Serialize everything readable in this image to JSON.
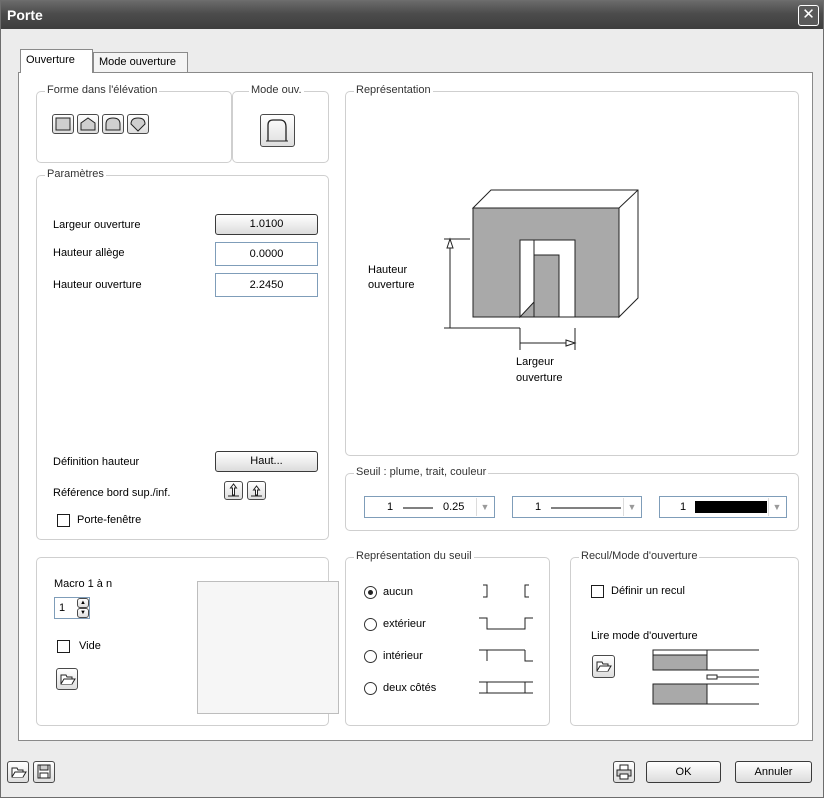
{
  "window": {
    "title": "Porte"
  },
  "tabs": [
    {
      "label": "Ouverture",
      "active": true
    },
    {
      "label": "Mode ouverture",
      "active": false
    }
  ],
  "forme": {
    "title": "Forme dans l'élévation",
    "icons": [
      "rectangle-shape-icon",
      "gable-shape-icon",
      "arch-shape-icon",
      "pointed-shape-icon"
    ]
  },
  "mode_ouv": {
    "title": "Mode ouv."
  },
  "parametres": {
    "title": "Paramètres",
    "largeur_label": "Largeur ouverture",
    "largeur_value": "1.0100",
    "hauteur_allege_label": "Hauteur allège",
    "hauteur_allege_value": "0.0000",
    "hauteur_ouverture_label": "Hauteur ouverture",
    "hauteur_ouverture_value": "2.2450",
    "definition_label": "Définition hauteur",
    "definition_button": "Haut...",
    "reference_label": "Référence bord sup./inf.",
    "porte_fenetre_label": "Porte-fenêtre"
  },
  "representation": {
    "title": "Représentation",
    "hauteur_line1": "Hauteur",
    "hauteur_line2": "ouverture",
    "largeur_line1": "Largeur",
    "largeur_line2": "ouverture"
  },
  "seuil": {
    "title": "Seuil : plume, trait, couleur",
    "pen_value": "1",
    "thickness_value": "0.25",
    "line_value": "1",
    "color_value": "1",
    "color_swatch": "#000000"
  },
  "macro": {
    "title": "",
    "label": "Macro 1 à n",
    "value": "1",
    "vide_label": "Vide"
  },
  "repr_seuil": {
    "title": "Représentation du seuil",
    "options": [
      "aucun",
      "extérieur",
      "intérieur",
      "deux côtés"
    ],
    "selected": "aucun"
  },
  "recul": {
    "title": "Recul/Mode d'ouverture",
    "definir_label": "Définir un recul",
    "lire_label": "Lire mode d'ouverture"
  },
  "footer": {
    "ok_label": "OK",
    "cancel_label": "Annuler"
  },
  "colors": {
    "wall_fill": "#a9a9a9",
    "titlebar": "#4c4c4c"
  }
}
